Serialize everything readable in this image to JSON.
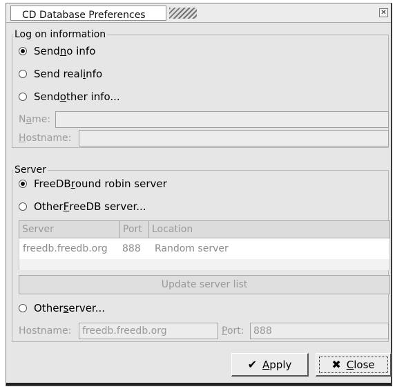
{
  "window": {
    "title": "CD Database Preferences",
    "close_glyph": "✕"
  },
  "logon": {
    "legend": "Log on information",
    "options": [
      {
        "pre": "Send ",
        "mn": "n",
        "post": "o info",
        "selected": true
      },
      {
        "pre": "Send real ",
        "mn": "i",
        "post": "nfo",
        "selected": false
      },
      {
        "pre": "Send ",
        "mn": "o",
        "post": "ther info...",
        "selected": false
      }
    ],
    "name_label": {
      "pre": "N",
      "mn": "a",
      "post": "me:"
    },
    "hostname_label": {
      "pre": "",
      "mn": "H",
      "post": "ostname:"
    },
    "name_value": "",
    "hostname_value": ""
  },
  "server": {
    "legend": "Server",
    "options": [
      {
        "pre": "FreeDB ",
        "mn": "r",
        "post": "ound robin server",
        "selected": true
      },
      {
        "pre": "Other ",
        "mn": "F",
        "post": "reeDB server...",
        "selected": false
      }
    ],
    "columns": [
      "Server",
      "Port",
      "Location"
    ],
    "rows": [
      {
        "server": "freedb.freedb.org",
        "port": "888",
        "location": "Random server"
      }
    ],
    "update_button": "Update server list",
    "other_option": {
      "pre": "Other ",
      "mn": "s",
      "post": "erver...",
      "selected": false
    },
    "hostname_label": "Hostname:",
    "hostname_value": "freedb.freedb.org",
    "port_label": {
      "pre": "",
      "mn": "P",
      "post": "ort:"
    },
    "port_value": "888"
  },
  "buttons": {
    "apply": {
      "pre": "",
      "mn": "A",
      "post": "pply",
      "icon": "✔"
    },
    "close": {
      "pre": "",
      "mn": "C",
      "post": "lose",
      "icon": "✖"
    }
  }
}
